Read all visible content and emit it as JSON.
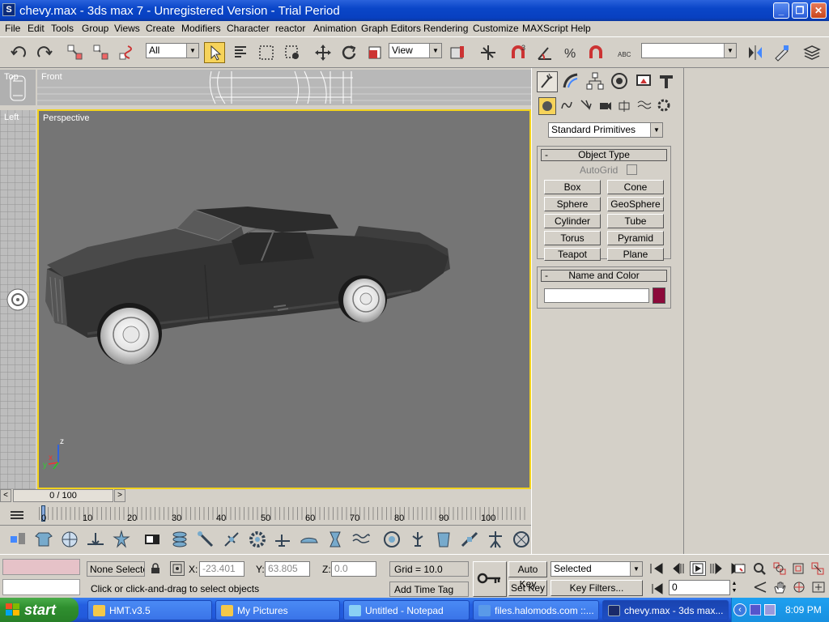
{
  "titlebar": {
    "app_icon": "S",
    "title": "chevy.max - 3ds max 7  - Unregistered Version - Trial Period",
    "min": "_",
    "max": "❐",
    "close": "✕"
  },
  "menu": [
    "File",
    "Edit",
    "Tools",
    "Group",
    "Views",
    "Create",
    "Modifiers",
    "Character",
    "reactor",
    "Animation",
    "Graph Editors",
    "Rendering",
    "Customize",
    "MAXScript",
    "Help"
  ],
  "toolbar": {
    "selection_filter": "All",
    "ref_coord": "View",
    "named_set": ""
  },
  "viewports": {
    "top": "Top",
    "front": "Front",
    "left": "Left",
    "perspective": "Perspective"
  },
  "axis": {
    "z": "z",
    "x": "x",
    "y": "y"
  },
  "cmd": {
    "primitive_type": "Standard Primitives",
    "object_type_title": "Object Type",
    "autogrid": "AutoGrid",
    "buttons": [
      "Box",
      "Cone",
      "Sphere",
      "GeoSphere",
      "Cylinder",
      "Tube",
      "Torus",
      "Pyramid",
      "Teapot",
      "Plane"
    ],
    "name_color_title": "Name and Color",
    "name_value": "",
    "object_color": "#8c0a3a",
    "collapse": "-"
  },
  "timeline": {
    "frame": "0 / 100",
    "prev": "<",
    "next": ">",
    "ticks": [
      "0",
      "10",
      "20",
      "30",
      "40",
      "50",
      "60",
      "70",
      "80",
      "90",
      "100"
    ]
  },
  "status": {
    "selection": "None Selecte",
    "x_label": "X:",
    "x": "-23.401",
    "y_label": "Y:",
    "y": "63.805",
    "z_label": "Z:",
    "z": "0.0",
    "grid": "Grid = 10.0",
    "prompt": "Click or click-and-drag to select objects",
    "add_time_tag": "Add Time Tag",
    "auto_key": "Auto Key",
    "set_key": "Set Key",
    "key_mode": "Selected",
    "key_filters": "Key Filters...",
    "frame": "0"
  },
  "taskbar": {
    "start": "start",
    "tasks": [
      "HMT.v3.5",
      "My Pictures",
      "Untitled - Notepad",
      "files.halomods.com ::...",
      "chevy.max - 3ds max..."
    ],
    "clock": "8:09 PM"
  }
}
